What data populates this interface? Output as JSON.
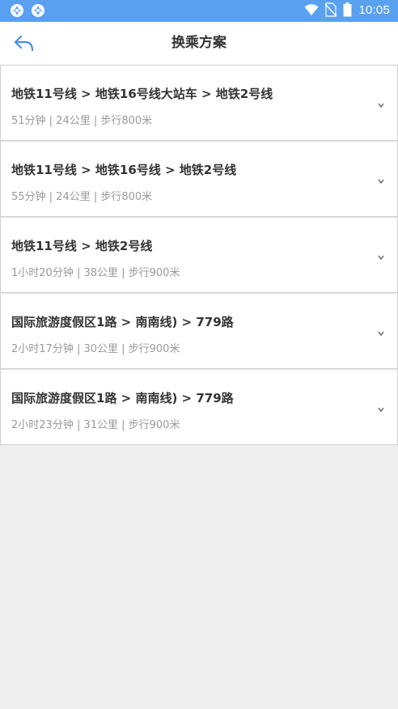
{
  "status_bar": {
    "time": "10:05",
    "icons": [
      "app-notification-icon",
      "app-notification-icon",
      "wifi-icon",
      "no-sim-icon",
      "battery-icon"
    ]
  },
  "header": {
    "title": "换乘方案",
    "back_icon": "back-arrow-icon"
  },
  "colors": {
    "status_bar": "#5aa0f0",
    "accent": "#4a8fe0",
    "title_text": "#333333",
    "meta_text": "#999999",
    "background": "#efefef"
  },
  "routes": [
    {
      "name": "地铁11号线 > 地铁16号线大站车 > 地铁2号线",
      "summary": "51分钟 | 24公里 | 步行800米"
    },
    {
      "name": "地铁11号线 > 地铁16号线 > 地铁2号线",
      "summary": "55分钟 | 24公里 | 步行800米"
    },
    {
      "name": "地铁11号线 > 地铁2号线",
      "summary": "1小时20分钟 | 38公里 | 步行900米"
    },
    {
      "name": "国际旅游度假区1路 > 南南线) > 779路",
      "summary": "2小时17分钟 | 30公里 | 步行900米"
    },
    {
      "name": "国际旅游度假区1路 > 南南线) > 779路",
      "summary": "2小时23分钟 | 31公里 | 步行900米"
    }
  ],
  "expand_icon": "chevron-down-icon"
}
